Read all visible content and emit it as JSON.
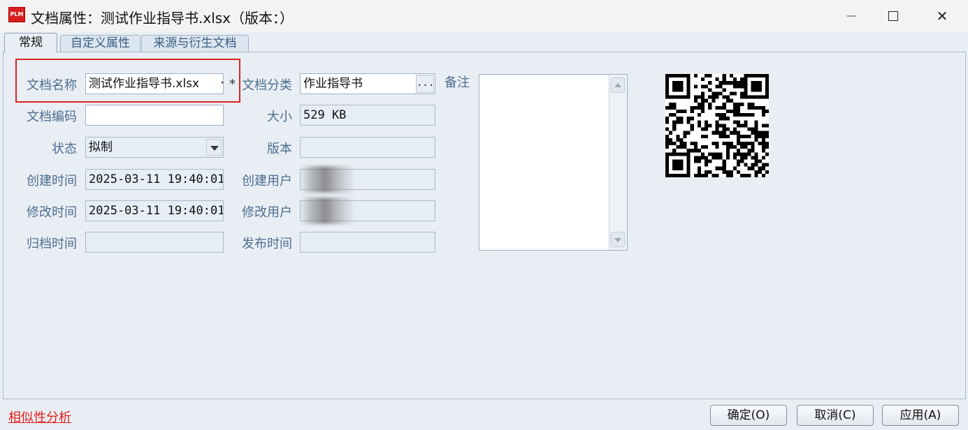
{
  "window": {
    "icon_text": "PLM",
    "title": "文档属性：测试作业指导书.xlsx（版本：）",
    "minimize": "—",
    "close": "✕"
  },
  "tabs": [
    {
      "label": "常规",
      "active": true
    },
    {
      "label": "自定义属性",
      "active": false
    },
    {
      "label": "来源与衍生文档",
      "active": false
    }
  ],
  "form": {
    "doc_name": {
      "label": "文档名称",
      "value": "测试作业指导书.xlsx"
    },
    "doc_code": {
      "label": "文档编码",
      "value": ""
    },
    "status": {
      "label": "状态",
      "value": "拟制"
    },
    "created_time": {
      "label": "创建时间",
      "value": "2025-03-11 19:40:01"
    },
    "modified_time": {
      "label": "修改时间",
      "value": "2025-03-11 19:40:01"
    },
    "archived_time": {
      "label": "归档时间",
      "value": ""
    },
    "required_mark": "*",
    "doc_category": {
      "label": "文档分类",
      "value": "作业指导书",
      "button": "..."
    },
    "size": {
      "label": "大小",
      "value": "529 KB"
    },
    "version": {
      "label": "版本",
      "value": ""
    },
    "created_user": {
      "label": "创建用户",
      "value": ""
    },
    "modified_user": {
      "label": "修改用户",
      "value": ""
    },
    "publish_time": {
      "label": "发布时间",
      "value": ""
    },
    "notes": {
      "label": "备注",
      "value": ""
    }
  },
  "footer": {
    "similarity_link": "相似性分析",
    "ok": "确定(O)",
    "cancel": "取消(C)",
    "apply": "应用(A)"
  },
  "colors": {
    "highlight": "#d9241f",
    "link": "#e0201b",
    "label": "#4d6e8e"
  }
}
